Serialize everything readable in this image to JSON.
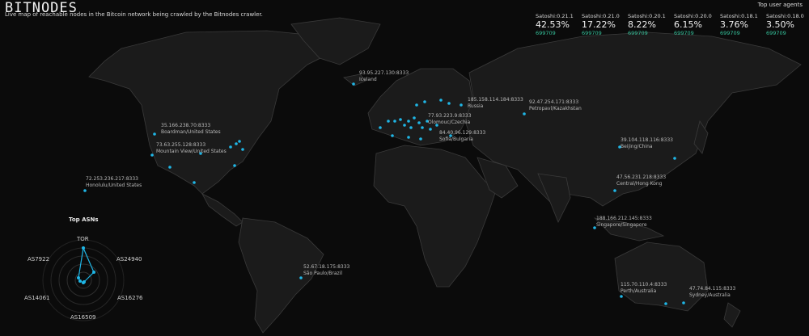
{
  "header": {
    "logo": "BITNODES",
    "subtitle": "Live map of reachable nodes in the Bitcoin network being crawled by the Bitnodes crawler."
  },
  "user_agents": {
    "title": "Top user agents",
    "items": [
      {
        "name": "Satoshi:0.21.1",
        "percent": "42.53%",
        "height": "699709"
      },
      {
        "name": "Satoshi:0.21.0",
        "percent": "17.22%",
        "height": "699709"
      },
      {
        "name": "Satoshi:0.20.1",
        "percent": "8.22%",
        "height": "699709"
      },
      {
        "name": "Satoshi:0.20.0",
        "percent": "6.15%",
        "height": "699709"
      },
      {
        "name": "Satoshi:0.18.1",
        "percent": "3.76%",
        "height": "699709"
      },
      {
        "name": "Satoshi:0.18.0",
        "percent": "3.50%",
        "height": "699709"
      }
    ],
    "height_color": "#35c29b"
  },
  "node_labels": [
    {
      "ip": "93.95.227.130:8333",
      "location": "Iceland"
    },
    {
      "ip": "185.158.114.184:8333",
      "location": "Russia"
    },
    {
      "ip": "92.47.254.171:8333",
      "location": "Petropavl/Kazakhstan"
    },
    {
      "ip": "77.93.223.9:8333",
      "location": "Olomouc/Czechia"
    },
    {
      "ip": "84.40.96.129:8333",
      "location": "Sofia/Bulgaria"
    },
    {
      "ip": "35.166.238.70:8333",
      "location": "Boardman/United States"
    },
    {
      "ip": "73.63.255.128:8333",
      "location": "Mountain View/United States"
    },
    {
      "ip": "72.253.236.217:8333",
      "location": "Honolulu/United States"
    },
    {
      "ip": "39.104.118.116:8333",
      "location": "Beijing/China"
    },
    {
      "ip": "47.56.231.218:8333",
      "location": "Central/Hong Kong"
    },
    {
      "ip": "188.166.212.145:8333",
      "location": "Singapore/Singapore"
    },
    {
      "ip": "52.67.18.175:8333",
      "location": "São Paulo/Brazil"
    },
    {
      "ip": "115.70.110.4:8333",
      "location": "Perth/Australia"
    },
    {
      "ip": "47.74.84.115:8333",
      "location": "Sydney/Australia"
    }
  ],
  "asn_chart": {
    "title": "Top ASNs",
    "labels": [
      "TOR",
      "AS24940",
      "AS16276",
      "AS16509",
      "AS14061",
      "AS7922"
    ]
  },
  "colors": {
    "node": "#1fb6e6",
    "land": "#1b1b1b",
    "border": "#3a3a3a",
    "background": "#0b0b0b"
  }
}
